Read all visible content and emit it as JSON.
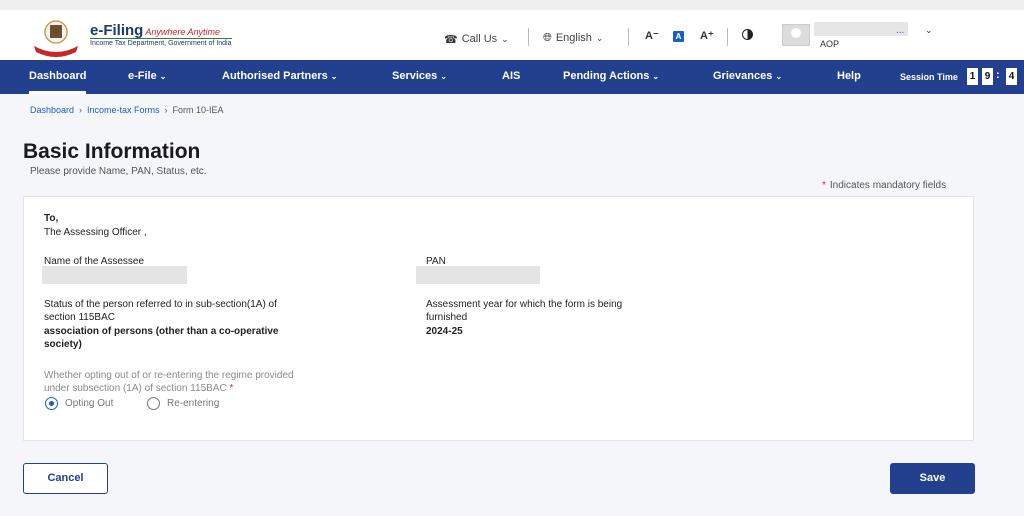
{
  "header": {
    "brand_title": "e-Filing",
    "brand_tagline": "Anywhere Anytime",
    "brand_subtitle": "Income Tax Department, Government of India",
    "call_us": "Call Us",
    "language": "English",
    "font_decrease": "A⁻",
    "font_default": "A",
    "font_increase": "A⁺",
    "user_dots": "... ",
    "user_type": "AOP"
  },
  "nav": {
    "items": [
      {
        "label": "Dashboard",
        "active": true
      },
      {
        "label": "e-File"
      },
      {
        "label": "Authorised Partners"
      },
      {
        "label": "Services"
      },
      {
        "label": "AIS"
      },
      {
        "label": "Pending Actions"
      },
      {
        "label": "Grievances"
      },
      {
        "label": "Help"
      }
    ],
    "session_label": "Session Time",
    "session_digits": [
      "1",
      "9",
      "4"
    ]
  },
  "breadcrumb": {
    "items": [
      "Dashboard",
      "Income-tax Forms",
      "Form 10-IEA"
    ]
  },
  "page": {
    "title": "Basic Information",
    "subtitle": "Please provide Name, PAN, Status, etc.",
    "mandatory_note": "Indicates mandatory fields"
  },
  "form": {
    "to_label": "To,",
    "to_value": "The Assessing Officer ,",
    "name_label": "Name of the Assessee",
    "pan_label": "PAN",
    "status_label_1": "Status of the person referred to in sub-section(1A) of",
    "status_label_2": "section 115BAC",
    "status_value_1": "association of persons (other than a co-operative",
    "status_value_2": "society)",
    "ay_label_1": "Assessment year for which the form is being",
    "ay_label_2": "furnished",
    "ay_value": "2024-25",
    "regime_question_1": "Whether opting out of or re-entering the regime provided",
    "regime_question_2": "under subsection (1A) of section 115BAC",
    "option_out": "Opting Out",
    "option_reenter": "Re-entering",
    "selected": "Opting Out"
  },
  "buttons": {
    "cancel": "Cancel",
    "save": "Save"
  },
  "colors": {
    "nav_bg": "#23408e",
    "link": "#1b5fc1",
    "required": "#d32f2f"
  }
}
